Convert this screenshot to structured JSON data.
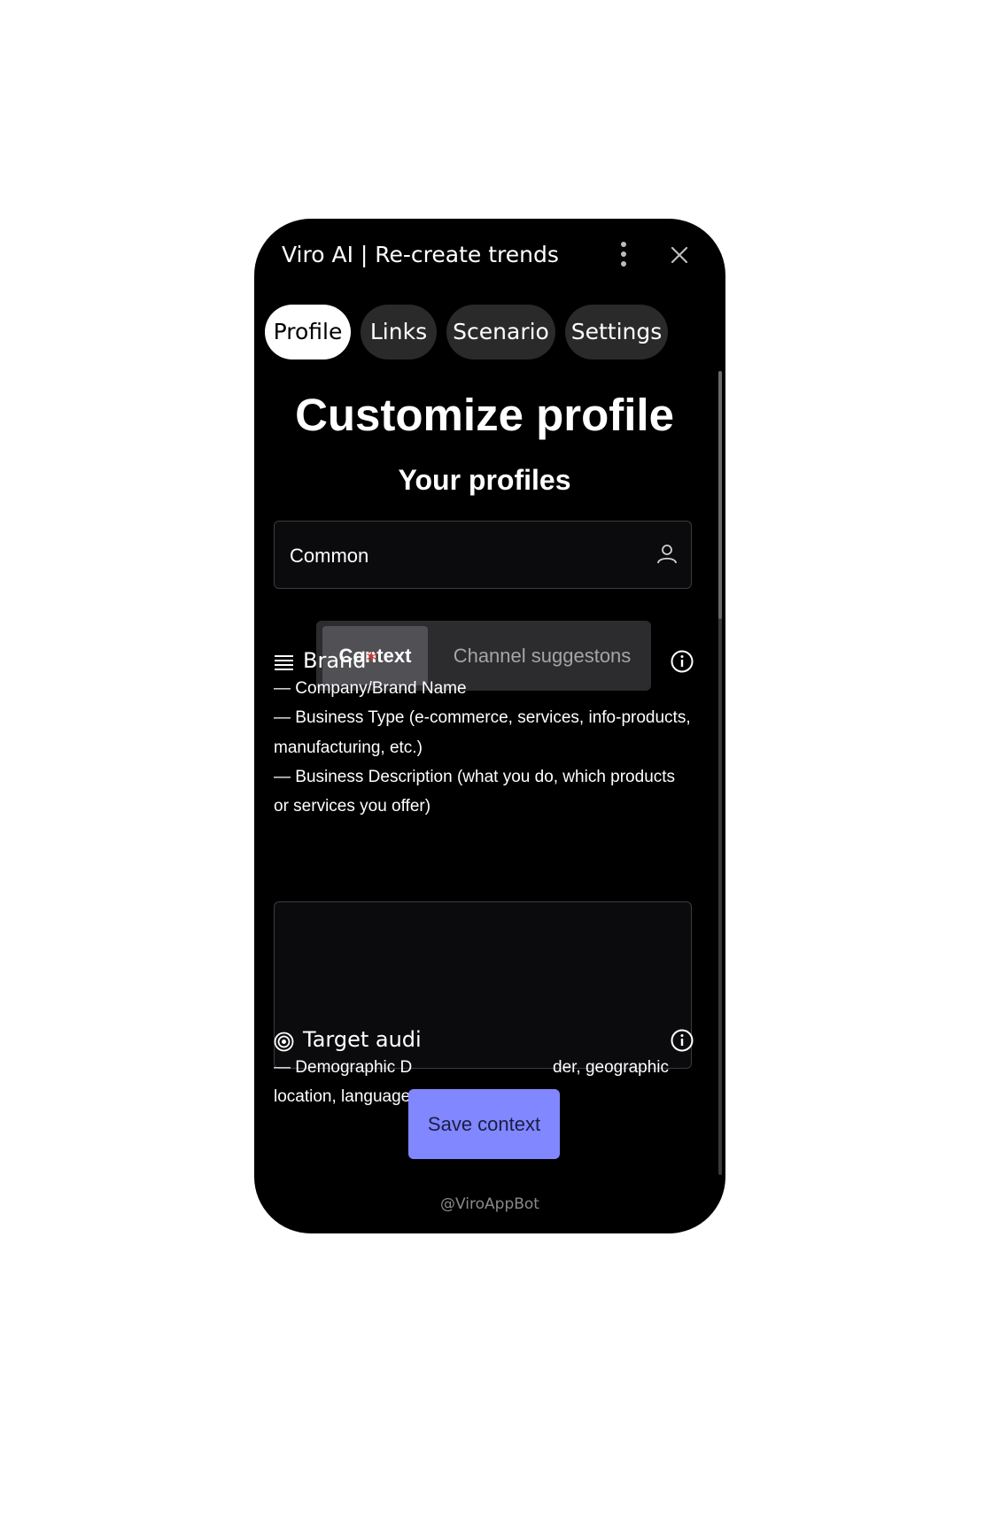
{
  "header": {
    "title": "Viro AI | Re-create trends"
  },
  "tabs": [
    {
      "label": "Profile",
      "active": true
    },
    {
      "label": "Links",
      "active": false
    },
    {
      "label": "Scenario",
      "active": false
    },
    {
      "label": "Settings",
      "active": false
    }
  ],
  "main": {
    "title": "Customize profile",
    "subtitle": "Your profiles",
    "profile_select": {
      "value": "Common",
      "icon": "person-icon"
    },
    "segments": [
      {
        "label": "Context",
        "active": true
      },
      {
        "label": "Channel suggestons",
        "active": false
      }
    ],
    "brand": {
      "title": "Brand",
      "required_mark": "*",
      "icon": "lines-icon",
      "desc": [
        "— Company/Brand Name",
        "— Business Type (e-commerce, services, info-products,",
        "manufacturing, etc.)",
        "— Business Description (what you do, which products",
        "or services you offer)"
      ],
      "value": ""
    },
    "target_audience": {
      "title": "Target audi",
      "icon": "target-icon",
      "desc": [
        "— Demographic D",
        "der, geographic",
        "location, language."
      ]
    },
    "save_label": "Save context"
  },
  "footer": {
    "bot": "@ViroAppBot"
  },
  "colors": {
    "accent": "#8087ff",
    "required": "#e0332a",
    "background": "#000000"
  }
}
